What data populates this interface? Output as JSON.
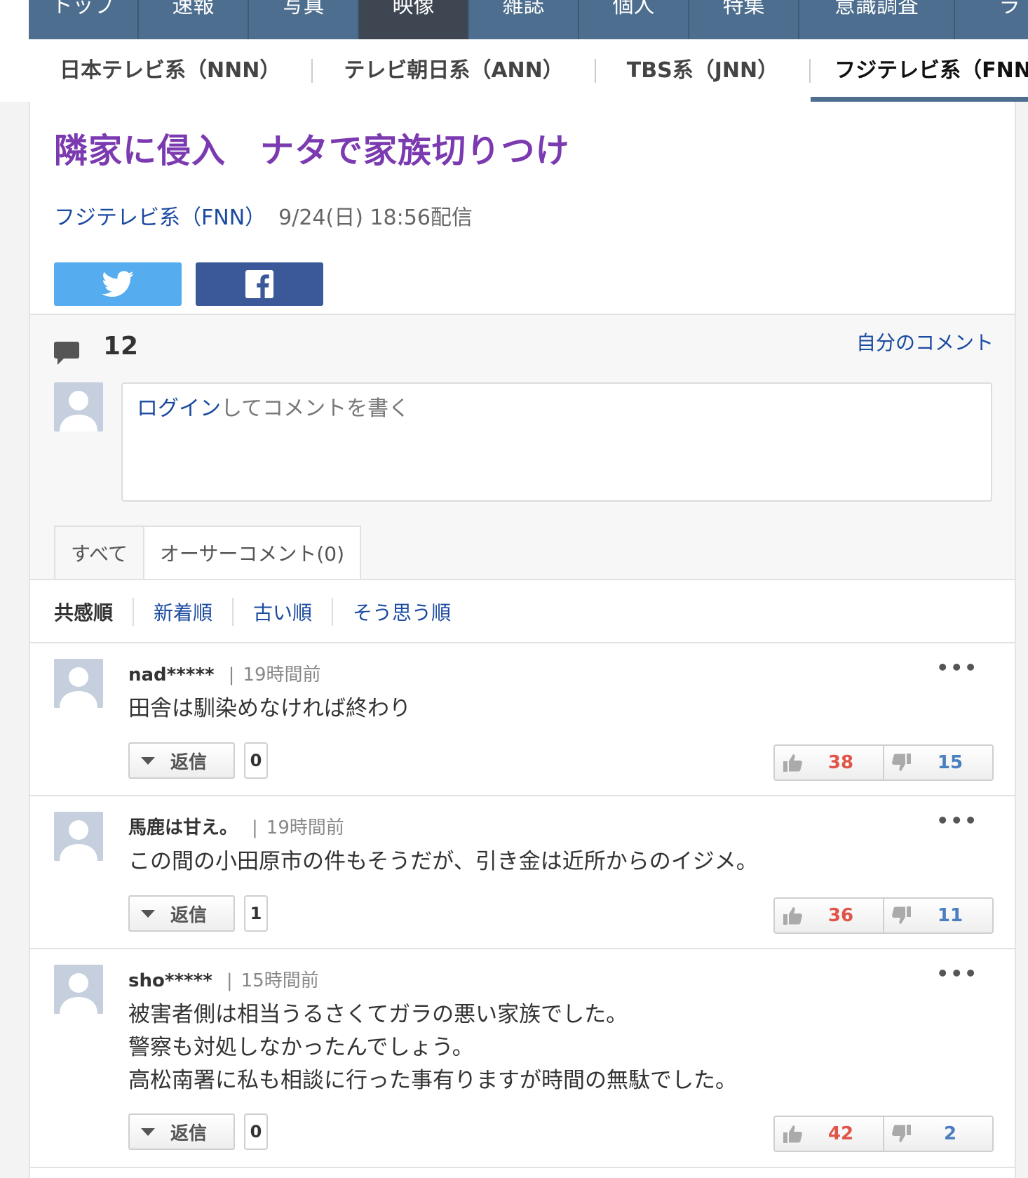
{
  "nav": {
    "items": [
      "トップ",
      "速報",
      "写真",
      "映像",
      "雑誌",
      "個人",
      "特集",
      "意識調査",
      "ラ"
    ],
    "active_index": 3
  },
  "subnav": {
    "items": [
      "日本テレビ系（NNN）",
      "テレビ朝日系（ANN）",
      "TBS系（JNN）",
      "フジテレビ系（FNN）"
    ],
    "active_index": 3
  },
  "article": {
    "title": "隣家に侵入　ナタで家族切りつけ",
    "source": "フジテレビ系（FNN）",
    "date": "9/24(日) 18:56配信"
  },
  "share": {
    "twitter_icon": "twitter-icon",
    "facebook_icon": "facebook-icon"
  },
  "comments_header": {
    "count": "12",
    "my_comments": "自分のコメント",
    "login_link": "ログイン",
    "prompt_rest": "してコメントを書く"
  },
  "tabs": [
    {
      "label": "すべて"
    },
    {
      "label": "オーサーコメント(0)"
    }
  ],
  "sort": {
    "items": [
      "共感順",
      "新着順",
      "古い順",
      "そう思う順"
    ],
    "active_index": 0
  },
  "comments": [
    {
      "user": "nad*****",
      "time": "19時間前",
      "text": "田舎は馴染めなければ終わり",
      "reply_label": "返信",
      "replies": "0",
      "likes": "38",
      "dislikes": "15"
    },
    {
      "user": "馬鹿は甘え。",
      "time": "19時間前",
      "text": "この間の小田原市の件もそうだが、引き金は近所からのイジメ。",
      "reply_label": "返信",
      "replies": "1",
      "likes": "36",
      "dislikes": "11"
    },
    {
      "user": "sho*****",
      "time": "15時間前",
      "text_lines": [
        "被害者側は相当うるさくてガラの悪い家族でした。",
        "警察も対処しなかったんでしょう。",
        "高松南署に私も相談に行った事有りますが時間の無駄でした。"
      ],
      "reply_label": "返信",
      "replies": "0",
      "likes": "42",
      "dislikes": "2"
    }
  ],
  "colors": {
    "nav_bg": "#4d6e8e",
    "nav_active": "#3e4652",
    "title": "#7b3ab0",
    "link": "#1a4aa0",
    "like": "#e0554a",
    "dislike": "#4a7fc1"
  }
}
